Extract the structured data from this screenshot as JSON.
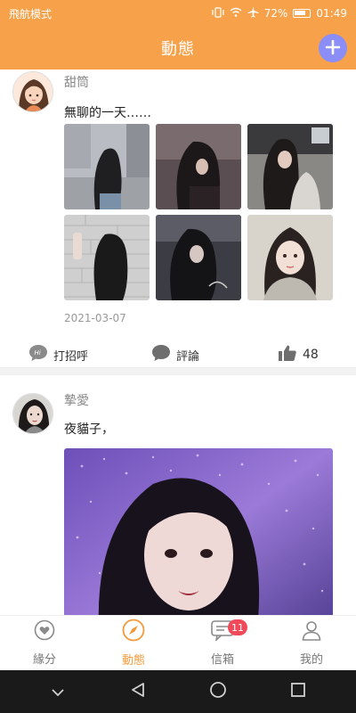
{
  "status_bar": {
    "mode": "飛航模式",
    "battery": "72%",
    "time": "01:49"
  },
  "header": {
    "title": "動態",
    "add_icon": "plus-icon"
  },
  "posts": [
    {
      "username": "甜筒",
      "caption": "無聊的一天……",
      "date": "2021-03-07",
      "photo_count": 6,
      "actions": {
        "greet_label": "打招呼",
        "comment_label": "評論",
        "like_count": "48"
      }
    },
    {
      "username": "摯愛",
      "caption": "夜貓子，"
    }
  ],
  "tabs": [
    {
      "label": "緣分",
      "icon": "heart-circle-icon"
    },
    {
      "label": "動態",
      "icon": "compass-icon",
      "active": true
    },
    {
      "label": "信箱",
      "icon": "chat-icon",
      "badge": "11"
    },
    {
      "label": "我的",
      "icon": "person-icon"
    }
  ],
  "colors": {
    "accent": "#f7a24a",
    "active_tab": "#f39a3b",
    "badge": "#f04a5a",
    "add_button": "#8b8ef7"
  }
}
